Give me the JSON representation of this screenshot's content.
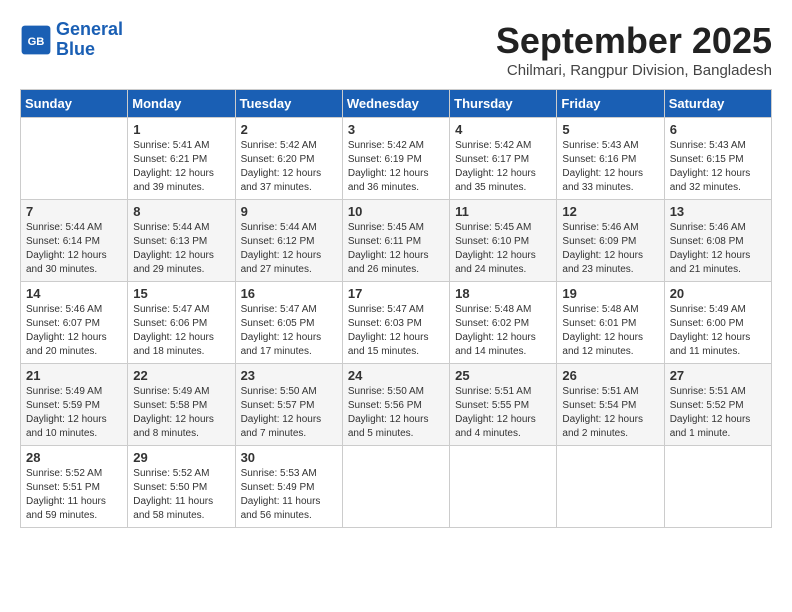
{
  "header": {
    "logo_line1": "General",
    "logo_line2": "Blue",
    "month": "September 2025",
    "location": "Chilmari, Rangpur Division, Bangladesh"
  },
  "days_of_week": [
    "Sunday",
    "Monday",
    "Tuesday",
    "Wednesday",
    "Thursday",
    "Friday",
    "Saturday"
  ],
  "weeks": [
    [
      {
        "day": "",
        "info": ""
      },
      {
        "day": "1",
        "info": "Sunrise: 5:41 AM\nSunset: 6:21 PM\nDaylight: 12 hours\nand 39 minutes."
      },
      {
        "day": "2",
        "info": "Sunrise: 5:42 AM\nSunset: 6:20 PM\nDaylight: 12 hours\nand 37 minutes."
      },
      {
        "day": "3",
        "info": "Sunrise: 5:42 AM\nSunset: 6:19 PM\nDaylight: 12 hours\nand 36 minutes."
      },
      {
        "day": "4",
        "info": "Sunrise: 5:42 AM\nSunset: 6:17 PM\nDaylight: 12 hours\nand 35 minutes."
      },
      {
        "day": "5",
        "info": "Sunrise: 5:43 AM\nSunset: 6:16 PM\nDaylight: 12 hours\nand 33 minutes."
      },
      {
        "day": "6",
        "info": "Sunrise: 5:43 AM\nSunset: 6:15 PM\nDaylight: 12 hours\nand 32 minutes."
      }
    ],
    [
      {
        "day": "7",
        "info": "Sunrise: 5:44 AM\nSunset: 6:14 PM\nDaylight: 12 hours\nand 30 minutes."
      },
      {
        "day": "8",
        "info": "Sunrise: 5:44 AM\nSunset: 6:13 PM\nDaylight: 12 hours\nand 29 minutes."
      },
      {
        "day": "9",
        "info": "Sunrise: 5:44 AM\nSunset: 6:12 PM\nDaylight: 12 hours\nand 27 minutes."
      },
      {
        "day": "10",
        "info": "Sunrise: 5:45 AM\nSunset: 6:11 PM\nDaylight: 12 hours\nand 26 minutes."
      },
      {
        "day": "11",
        "info": "Sunrise: 5:45 AM\nSunset: 6:10 PM\nDaylight: 12 hours\nand 24 minutes."
      },
      {
        "day": "12",
        "info": "Sunrise: 5:46 AM\nSunset: 6:09 PM\nDaylight: 12 hours\nand 23 minutes."
      },
      {
        "day": "13",
        "info": "Sunrise: 5:46 AM\nSunset: 6:08 PM\nDaylight: 12 hours\nand 21 minutes."
      }
    ],
    [
      {
        "day": "14",
        "info": "Sunrise: 5:46 AM\nSunset: 6:07 PM\nDaylight: 12 hours\nand 20 minutes."
      },
      {
        "day": "15",
        "info": "Sunrise: 5:47 AM\nSunset: 6:06 PM\nDaylight: 12 hours\nand 18 minutes."
      },
      {
        "day": "16",
        "info": "Sunrise: 5:47 AM\nSunset: 6:05 PM\nDaylight: 12 hours\nand 17 minutes."
      },
      {
        "day": "17",
        "info": "Sunrise: 5:47 AM\nSunset: 6:03 PM\nDaylight: 12 hours\nand 15 minutes."
      },
      {
        "day": "18",
        "info": "Sunrise: 5:48 AM\nSunset: 6:02 PM\nDaylight: 12 hours\nand 14 minutes."
      },
      {
        "day": "19",
        "info": "Sunrise: 5:48 AM\nSunset: 6:01 PM\nDaylight: 12 hours\nand 12 minutes."
      },
      {
        "day": "20",
        "info": "Sunrise: 5:49 AM\nSunset: 6:00 PM\nDaylight: 12 hours\nand 11 minutes."
      }
    ],
    [
      {
        "day": "21",
        "info": "Sunrise: 5:49 AM\nSunset: 5:59 PM\nDaylight: 12 hours\nand 10 minutes."
      },
      {
        "day": "22",
        "info": "Sunrise: 5:49 AM\nSunset: 5:58 PM\nDaylight: 12 hours\nand 8 minutes."
      },
      {
        "day": "23",
        "info": "Sunrise: 5:50 AM\nSunset: 5:57 PM\nDaylight: 12 hours\nand 7 minutes."
      },
      {
        "day": "24",
        "info": "Sunrise: 5:50 AM\nSunset: 5:56 PM\nDaylight: 12 hours\nand 5 minutes."
      },
      {
        "day": "25",
        "info": "Sunrise: 5:51 AM\nSunset: 5:55 PM\nDaylight: 12 hours\nand 4 minutes."
      },
      {
        "day": "26",
        "info": "Sunrise: 5:51 AM\nSunset: 5:54 PM\nDaylight: 12 hours\nand 2 minutes."
      },
      {
        "day": "27",
        "info": "Sunrise: 5:51 AM\nSunset: 5:52 PM\nDaylight: 12 hours\nand 1 minute."
      }
    ],
    [
      {
        "day": "28",
        "info": "Sunrise: 5:52 AM\nSunset: 5:51 PM\nDaylight: 11 hours\nand 59 minutes."
      },
      {
        "day": "29",
        "info": "Sunrise: 5:52 AM\nSunset: 5:50 PM\nDaylight: 11 hours\nand 58 minutes."
      },
      {
        "day": "30",
        "info": "Sunrise: 5:53 AM\nSunset: 5:49 PM\nDaylight: 11 hours\nand 56 minutes."
      },
      {
        "day": "",
        "info": ""
      },
      {
        "day": "",
        "info": ""
      },
      {
        "day": "",
        "info": ""
      },
      {
        "day": "",
        "info": ""
      }
    ]
  ]
}
